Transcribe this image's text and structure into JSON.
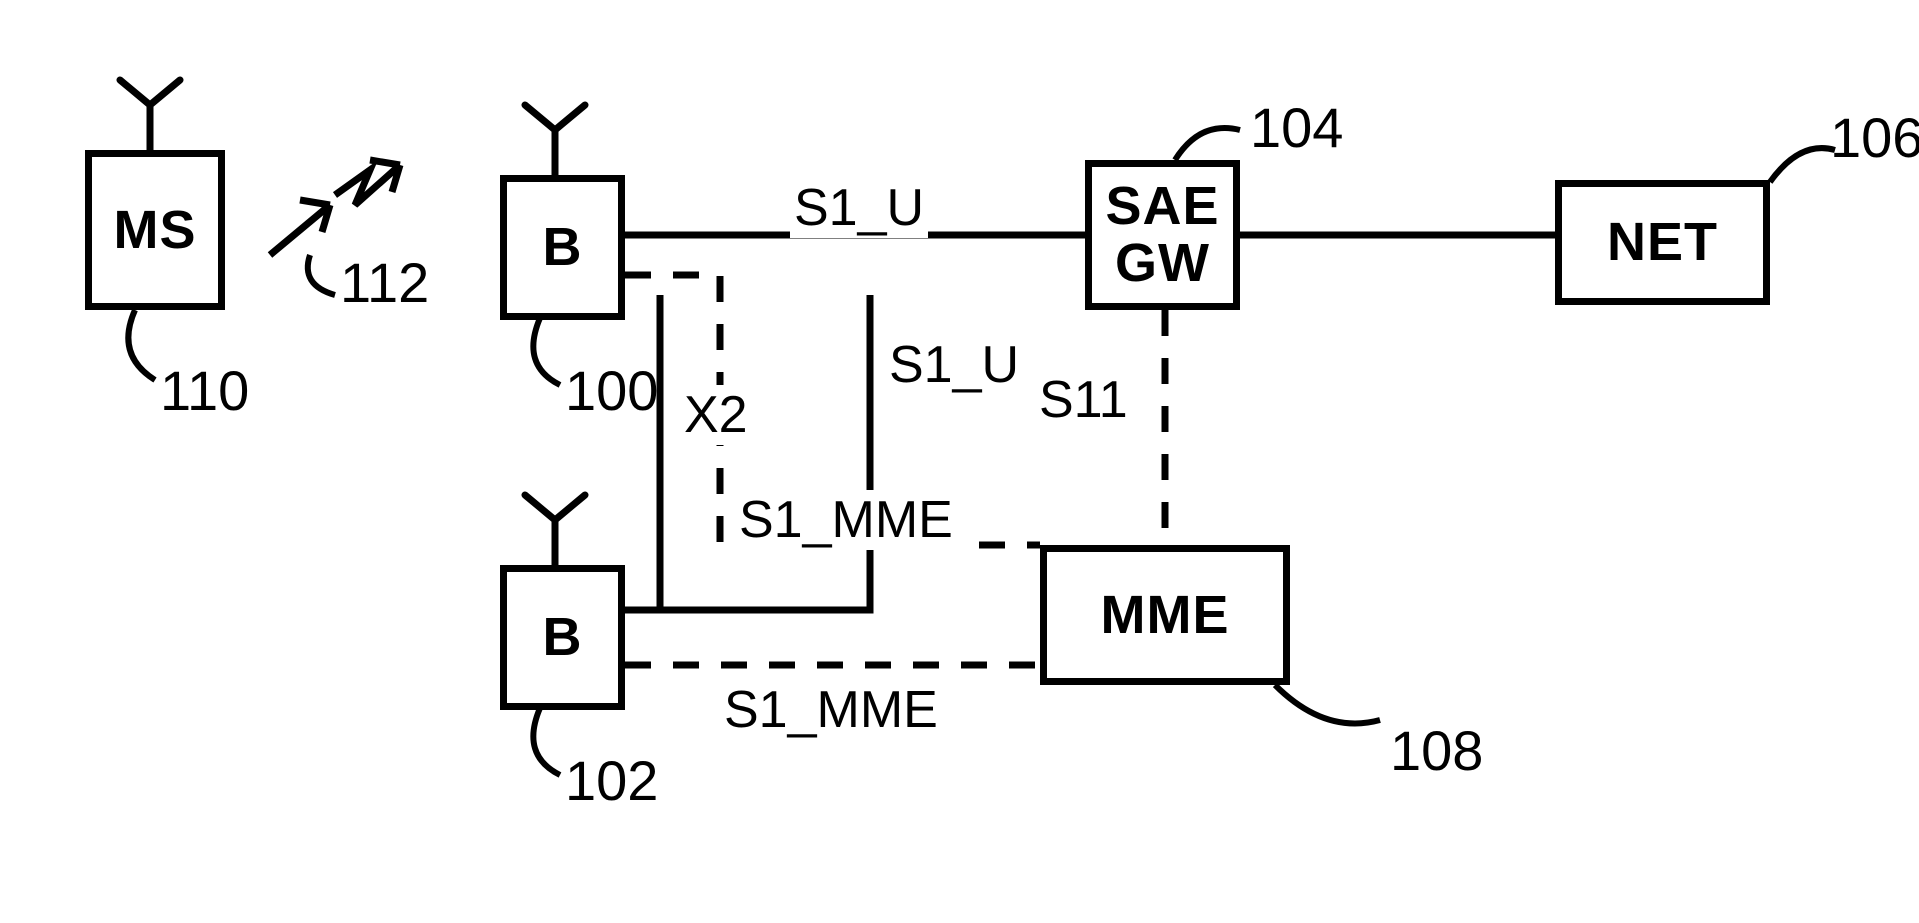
{
  "nodes": {
    "ms": {
      "label": "MS"
    },
    "b1": {
      "label": "B"
    },
    "b2": {
      "label": "B"
    },
    "sae": {
      "label": "SAE\nGW"
    },
    "net": {
      "label": "NET"
    },
    "mme": {
      "label": "MME"
    }
  },
  "refs": {
    "ms": "110",
    "air": "112",
    "b1": "100",
    "b2": "102",
    "sae": "104",
    "net": "106",
    "mme": "108"
  },
  "links": {
    "b1_sae": "S1_U",
    "b2_sae": "S1_U",
    "b1_b2": "X2",
    "sae_mme": "S11",
    "b1_mme": "S1_MME",
    "b2_mme": "S1_MME"
  }
}
